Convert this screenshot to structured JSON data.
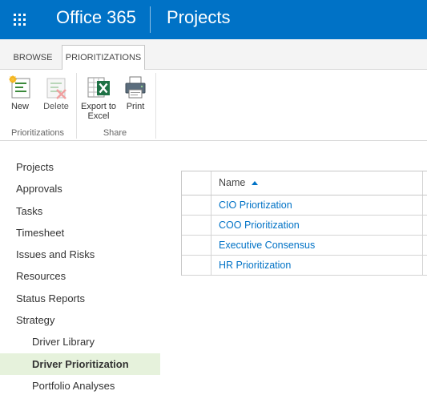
{
  "suite_bar": {
    "brand": "Office 365",
    "site_title": "Projects",
    "color": "#0072c6"
  },
  "ribbon": {
    "tabs": [
      {
        "label": "BROWSE",
        "selected": false
      },
      {
        "label": "PRIORITIZATIONS",
        "selected": true
      }
    ],
    "groups": [
      {
        "label": "Prioritizations",
        "buttons": [
          {
            "label": "New",
            "icon": "new-item-icon",
            "enabled": true
          },
          {
            "label": "Delete",
            "icon": "delete-item-icon",
            "enabled": false
          }
        ]
      },
      {
        "label": "Share",
        "buttons": [
          {
            "label_line1": "Export to",
            "label_line2": "Excel",
            "icon": "excel-icon",
            "enabled": true
          },
          {
            "label": "Print",
            "icon": "printer-icon",
            "enabled": true
          }
        ]
      }
    ]
  },
  "nav": {
    "items": [
      {
        "label": "Projects"
      },
      {
        "label": "Approvals"
      },
      {
        "label": "Tasks"
      },
      {
        "label": "Timesheet"
      },
      {
        "label": "Issues and Risks"
      },
      {
        "label": "Resources"
      },
      {
        "label": "Status Reports"
      },
      {
        "label": "Strategy"
      },
      {
        "label": "Driver Library",
        "sub": true
      },
      {
        "label": "Driver Prioritization",
        "sub": true,
        "selected": true
      },
      {
        "label": "Portfolio Analyses",
        "sub": true
      }
    ]
  },
  "list": {
    "column_header": "Name",
    "sort": "ascending",
    "rows": [
      {
        "name": "CIO Priortization"
      },
      {
        "name": "COO Prioritization"
      },
      {
        "name": "Executive Consensus"
      },
      {
        "name": "HR Prioritization"
      }
    ],
    "link_color": "#0072c6"
  }
}
